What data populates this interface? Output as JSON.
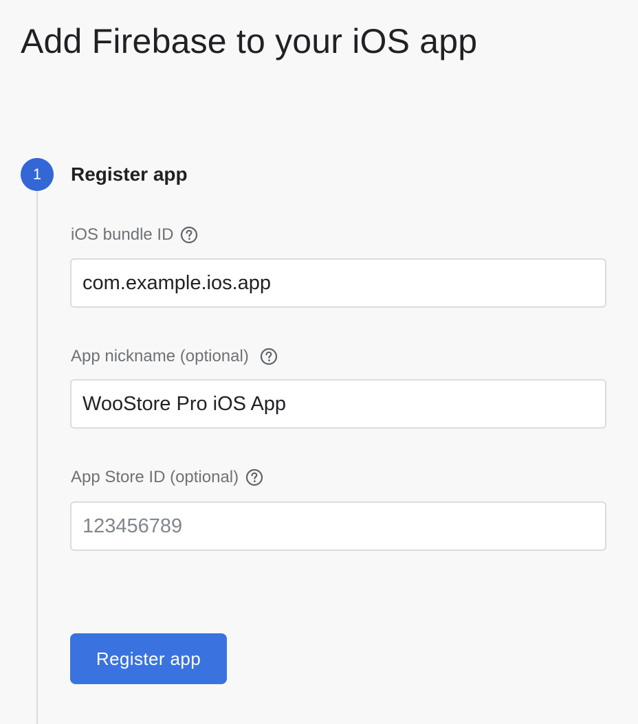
{
  "page": {
    "title": "Add Firebase to your iOS app"
  },
  "step": {
    "number": "1",
    "title": "Register app"
  },
  "fields": {
    "bundle_id": {
      "label": "iOS bundle ID",
      "value": "com.example.ios.app",
      "help_icon": "help-circle-icon"
    },
    "nickname": {
      "label": "App nickname (optional)",
      "value": "WooStore Pro iOS App",
      "help_icon": "help-circle-icon"
    },
    "app_store_id": {
      "label": "App Store ID (optional)",
      "value": "",
      "placeholder": "123456789",
      "help_icon": "help-circle-icon"
    }
  },
  "actions": {
    "register_label": "Register app"
  },
  "colors": {
    "accent": "#3367d6",
    "button": "#3a73e0",
    "background": "#f8f8f8",
    "label": "#6f7175",
    "border": "#dadce0"
  }
}
